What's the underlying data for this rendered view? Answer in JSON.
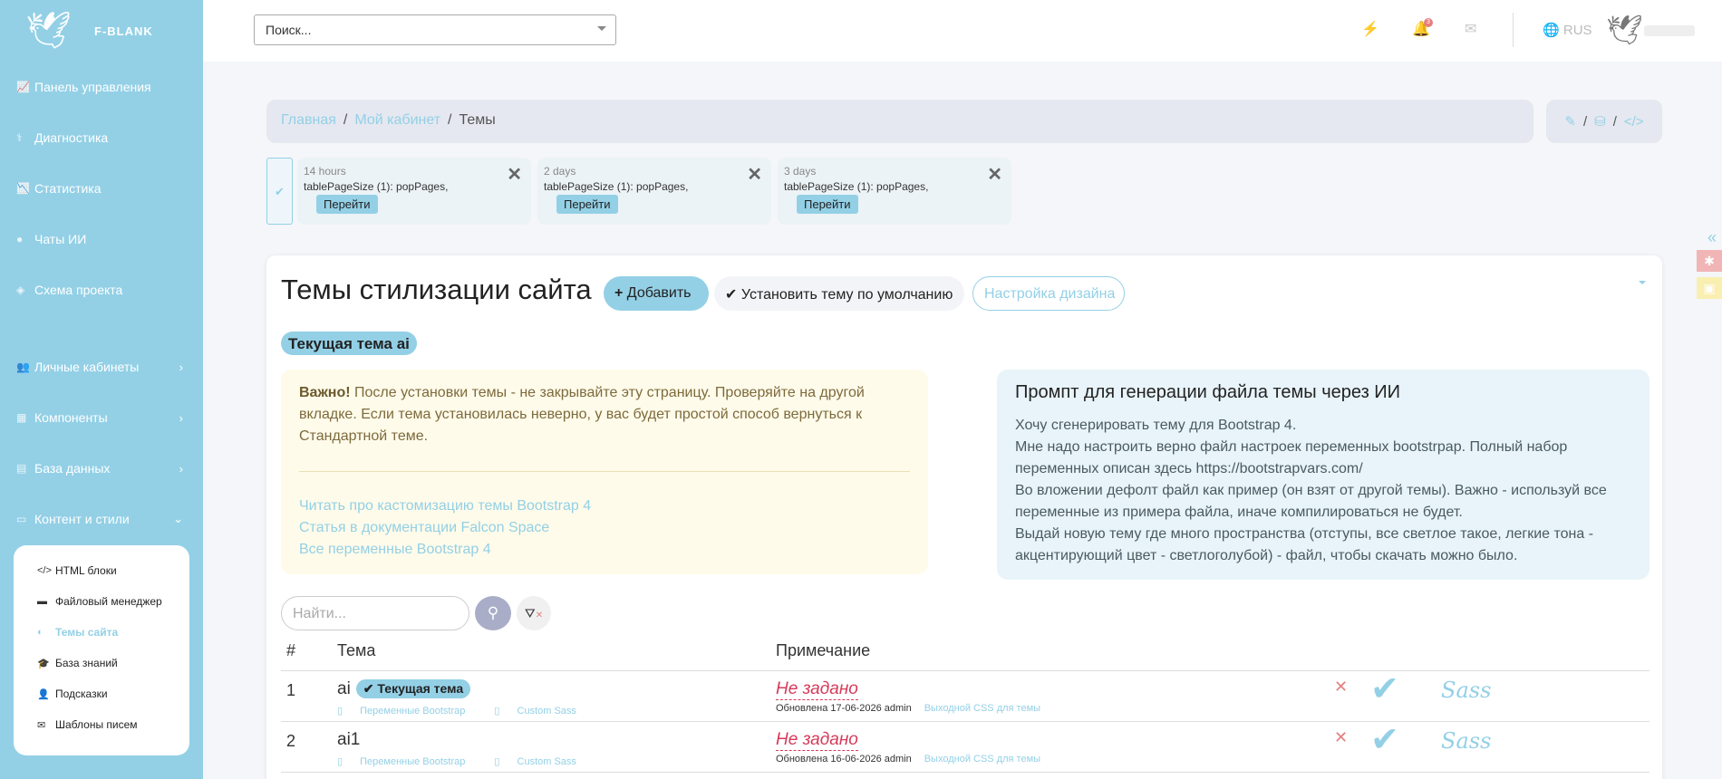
{
  "logo": {
    "text": "F-BLANK"
  },
  "sidebar": {
    "items": [
      {
        "label": "Панель управления",
        "icon": "chart-icon",
        "arrow": ""
      },
      {
        "label": "Диагностика",
        "icon": "diagnostics-icon",
        "arrow": ""
      },
      {
        "label": "Статистика",
        "icon": "stats-icon",
        "arrow": ""
      },
      {
        "label": "Чаты ИИ",
        "icon": "chat-icon",
        "arrow": ""
      },
      {
        "label": "Схема проекта",
        "icon": "scheme-icon",
        "arrow": ""
      },
      {
        "label": "Личные кабинеты",
        "icon": "users-icon",
        "arrow": "›"
      },
      {
        "label": "Компоненты",
        "icon": "components-icon",
        "arrow": "›"
      },
      {
        "label": "База данных",
        "icon": "database-icon",
        "arrow": "›"
      },
      {
        "label": "Контент и стили",
        "icon": "content-icon",
        "arrow": "⌄"
      }
    ],
    "submenu": [
      {
        "label": "HTML блоки",
        "icon": "code-icon"
      },
      {
        "label": "Файловый менеджер",
        "icon": "folder-icon"
      },
      {
        "label": "Темы сайта",
        "icon": "palette-icon"
      },
      {
        "label": "База знаний",
        "icon": "graduation-icon"
      },
      {
        "label": "Подсказки",
        "icon": "user-tie-icon"
      },
      {
        "label": "Шаблоны писем",
        "icon": "mail-template-icon"
      }
    ]
  },
  "topbar": {
    "search_placeholder": "Поиск...",
    "lang": "RUS",
    "notif_count": "3"
  },
  "breadcrumb": {
    "home": "Главная",
    "cabinet": "Мой кабинет",
    "current": "Темы",
    "sep": "/"
  },
  "recent": [
    {
      "time": "14 hours",
      "text": "tablePageSize (1): popPages,",
      "go": "Перейти"
    },
    {
      "time": "2 days",
      "text": "tablePageSize (1): popPages,",
      "go": "Перейти"
    },
    {
      "time": "3 days",
      "text": "tablePageSize (1): popPages,",
      "go": "Перейти"
    }
  ],
  "main": {
    "title": "Темы стилизации сайта",
    "add_label": "Добавить",
    "default_label": "Установить тему по умолчанию",
    "design_label": "Настройка дизайна",
    "current_theme": "Текущая тема ai"
  },
  "warning": {
    "bold": "Важно!",
    "text": "После установки темы - не закрывайте эту страницу. Проверяйте на другой вкладке. Если тема установилась неверно, у вас будет простой способ вернуться к Стандартной теме.",
    "links": [
      "Читать про кастомизацию темы Bootstrap 4",
      "Статья в документации Falcon Space",
      "Все переменные Bootstrap 4"
    ]
  },
  "prompt": {
    "title": "Промпт для генерации файла темы через ИИ",
    "lines": [
      "Хочу сгенерировать тему для Bootstrap 4.",
      "Мне надо настроить верно файл настроек переменных bootstrpap. Полный набор переменных описан здесь https://bootstrapvars.com/",
      "Во вложении дефолт файл как пример (он взят от другой темы). Важно - используй все переменные из примера файла, иначе компилироваться не будет.",
      "Выдай новую тему где много пространства (отступы, все светлое такое, легкие тона - акцентирующий цвет - светлоголубой) - файл, чтобы скачать можно было."
    ]
  },
  "table": {
    "search_placeholder": "Найти...",
    "headers": {
      "num": "#",
      "theme": "Тема",
      "note": "Примечание"
    },
    "rows": [
      {
        "num": "1",
        "name": "ai",
        "badge": "Текущая тема",
        "vars": "Переменные Bootstrap",
        "sass": "Custom Sass",
        "note": "Не задано",
        "updated": "Обновлена 17-06-2026 admin",
        "css": "Выходной CSS для темы",
        "sass_logo": "Sass"
      },
      {
        "num": "2",
        "name": "ai1",
        "badge": "",
        "vars": "Переменные Bootstrap",
        "sass": "Custom Sass",
        "note": "Не задано",
        "updated": "Обновлена 16-06-2026 admin",
        "css": "Выходной CSS для темы",
        "sass_logo": "Sass"
      }
    ]
  },
  "colors": {
    "accent": "#93d0e6",
    "danger": "#e67e7e",
    "note": "#d63a5a"
  }
}
